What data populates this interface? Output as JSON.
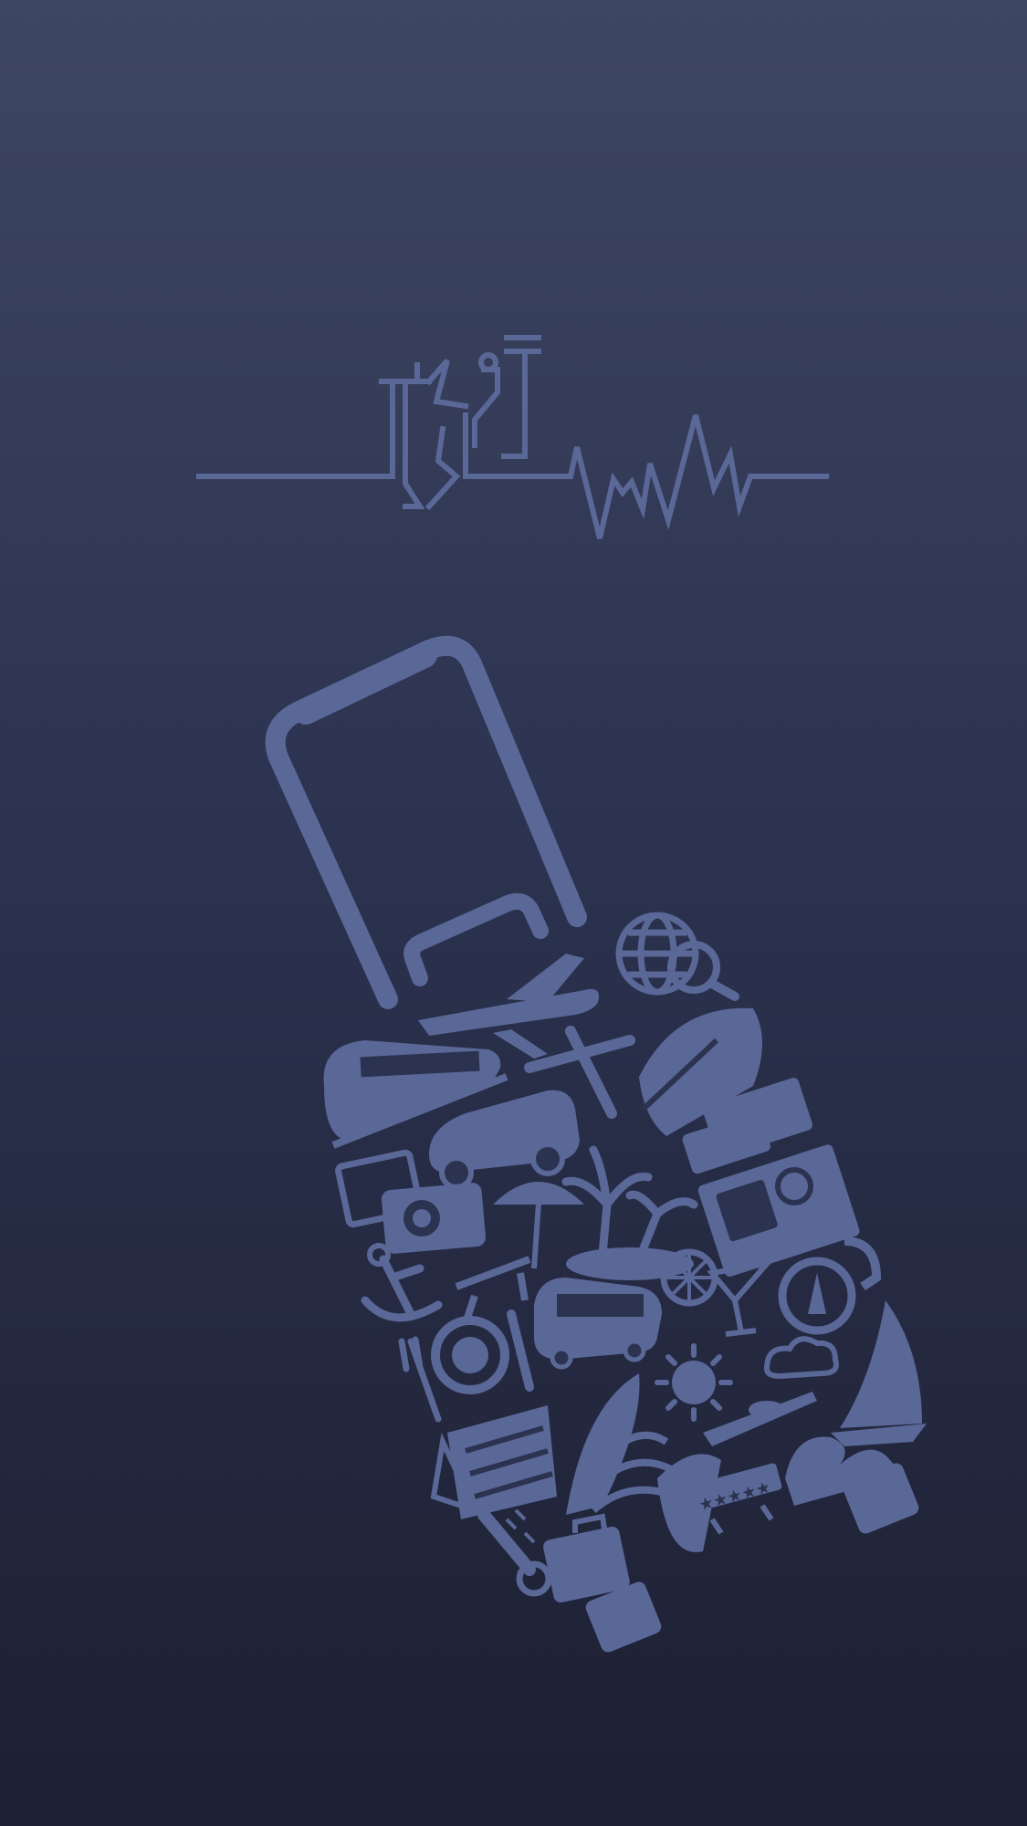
{
  "logo": {
    "title": "旅行"
  },
  "colors": {
    "background_top": "#3d4662",
    "background_bottom": "#1d2032",
    "icon_color": "#5a6898"
  }
}
